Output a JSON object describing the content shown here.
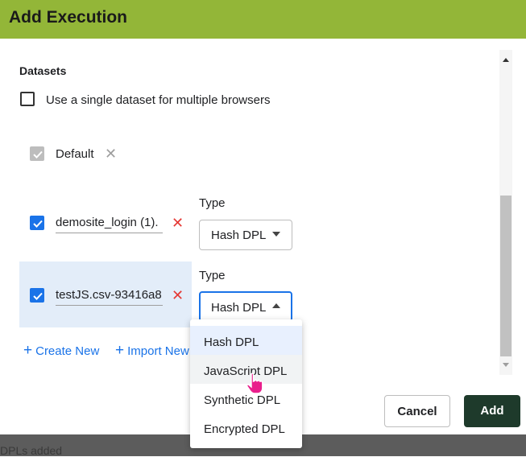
{
  "dialog": {
    "title": "Add Execution"
  },
  "datasets": {
    "section_title": "Datasets",
    "single_dataset_label": "Use a single dataset for multiple browsers",
    "rows": [
      {
        "name": "Default",
        "checked": true,
        "disabled": true
      },
      {
        "name": "demosite_login (1).",
        "checked": true,
        "type_label": "Type",
        "type_value": "Hash DPL"
      },
      {
        "name": "testJS.csv-93416a8",
        "checked": true,
        "type_label": "Type",
        "type_value": "Hash DPL"
      }
    ]
  },
  "type_dropdown": {
    "options": [
      "Hash DPL",
      "JavaScript DPL",
      "Synthetic DPL",
      "Encrypted DPL"
    ],
    "selected": "Hash DPL",
    "hovered": "JavaScript DPL"
  },
  "links": {
    "create_new": "Create New",
    "import_new": "Import New"
  },
  "buttons": {
    "cancel": "Cancel",
    "add": "Add"
  },
  "background": {
    "text": "DPLs added"
  },
  "colors": {
    "header": "#93b638",
    "accent": "#1a73e8",
    "remove": "#e53935",
    "add_button": "#1e3a2b"
  },
  "icons": {
    "checkbox_check": "check-icon",
    "remove": "close-icon",
    "link_plus": "plus-icon",
    "dropdown_arrow": "caret-icon",
    "cursor": "hand-pointer-icon"
  }
}
